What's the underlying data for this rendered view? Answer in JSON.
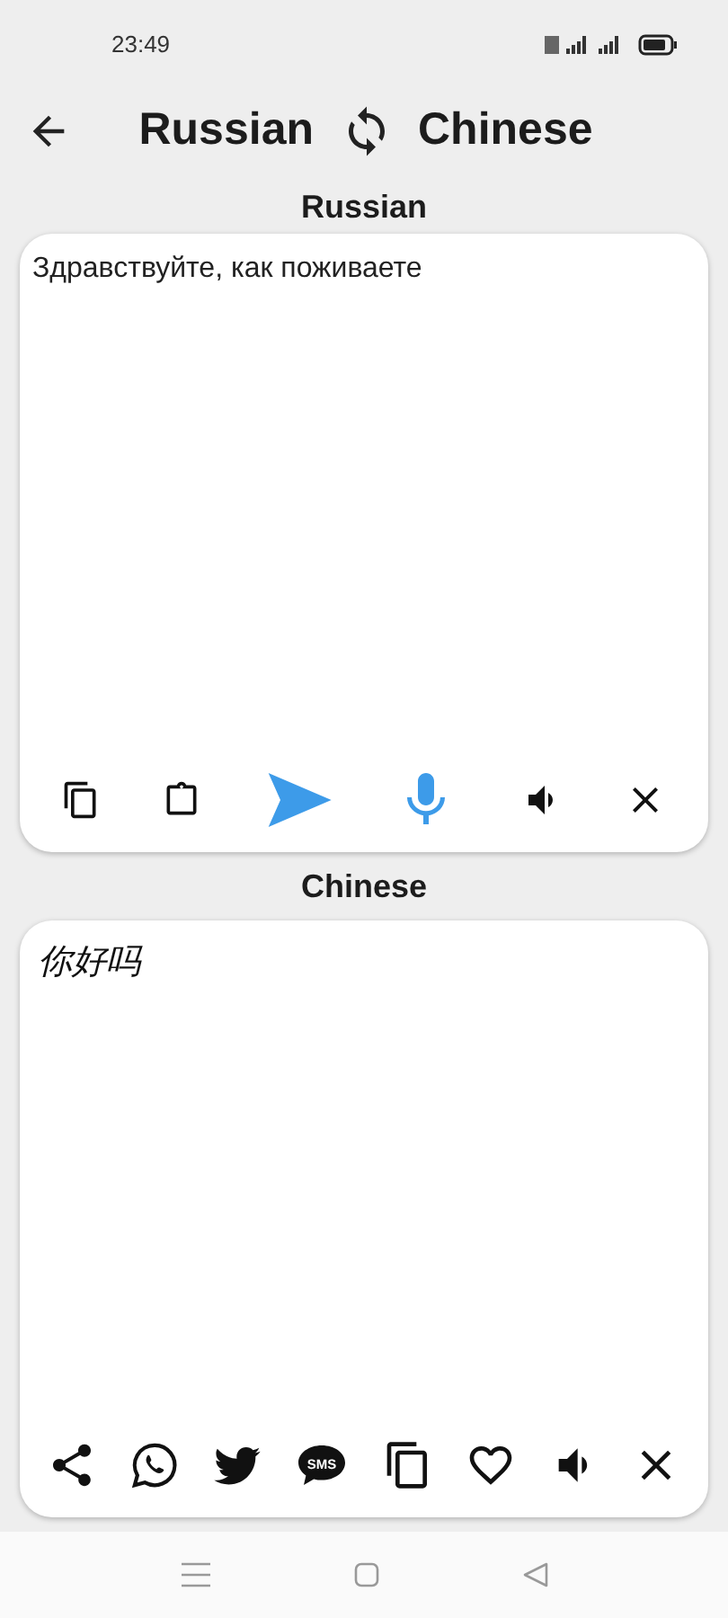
{
  "status_bar": {
    "time": "23:49"
  },
  "header": {
    "source_language": "Russian",
    "target_language": "Chinese"
  },
  "input_panel": {
    "label": "Russian",
    "text": "Здравствуйте, как поживаете"
  },
  "output_panel": {
    "label": "Chinese",
    "text": "你好吗",
    "sms_label": "SMS"
  }
}
